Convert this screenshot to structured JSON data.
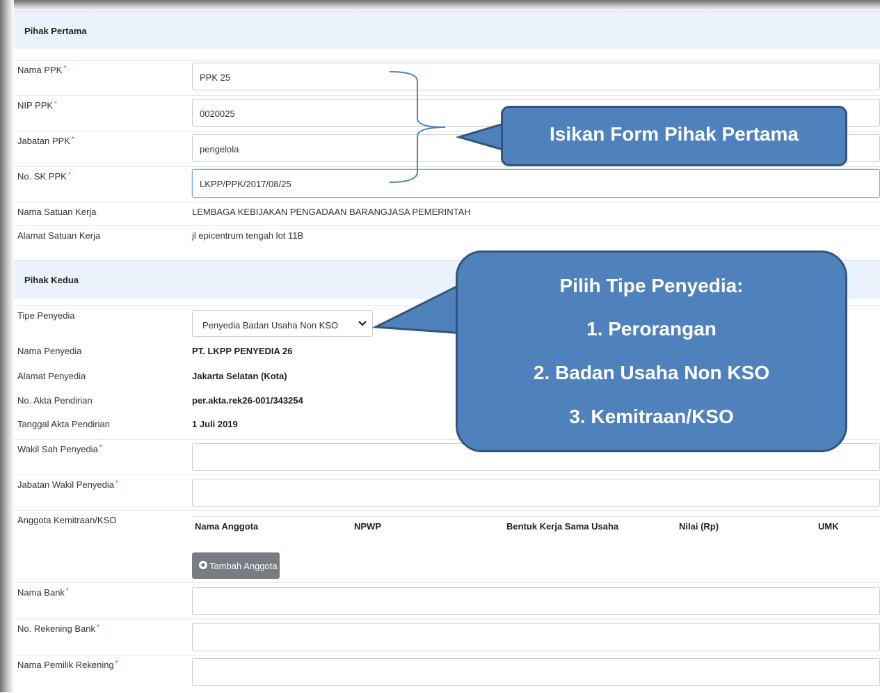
{
  "pihak_pertama": {
    "title": "Pihak Pertama",
    "nama_ppk": {
      "label": "Nama PPK",
      "value": "PPK 25"
    },
    "nip_ppk": {
      "label": "NIP PPK",
      "value": "0020025"
    },
    "jabatan_ppk": {
      "label": "Jabatan PPK",
      "value": "pengelola"
    },
    "no_sk_ppk": {
      "label": "No. SK PPK",
      "value": "LKPP/PPK/2017/08/25"
    },
    "nama_satker": {
      "label": "Nama Satuan Kerja",
      "value": "LEMBAGA KEBIJAKAN PENGADAAN BARANGJASA PEMERINTAH"
    },
    "alamat_satker": {
      "label": "Alamat Satuan Kerja",
      "value": "jl epicentrum tengah lot 11B"
    }
  },
  "pihak_kedua": {
    "title": "Pihak Kedua",
    "tipe_penyedia": {
      "label": "Tipe Penyedia",
      "value": "Penyedia Badan Usaha Non KSO"
    },
    "nama_penyedia": {
      "label": "Nama Penyedia",
      "value": "PT. LKPP PENYEDIA 26"
    },
    "alamat_penyedia": {
      "label": "Alamat Penyedia",
      "value": "Jakarta Selatan (Kota)"
    },
    "no_akta": {
      "label": "No. Akta Pendirian",
      "value": "per.akta.rek26-001/343254"
    },
    "tanggal_akta": {
      "label": "Tanggal Akta Pendirian",
      "value": "1 Juli 2019"
    },
    "wakil_sah": {
      "label": "Wakil Sah Penyedia",
      "value": ""
    },
    "jabatan_wakil": {
      "label": "Jabatan Wakil Penyedia",
      "value": ""
    },
    "anggota": {
      "label": "Anggota Kemitraan/KSO",
      "columns": [
        "Nama Anggota",
        "NPWP",
        "Bentuk Kerja Sama Usaha",
        "Nilai (Rp)",
        "UMK"
      ],
      "add_button": "Tambah Anggota"
    },
    "nama_bank": {
      "label": "Nama Bank",
      "value": ""
    },
    "no_rekening": {
      "label": "No. Rekening Bank",
      "value": ""
    },
    "nama_pemilik": {
      "label": "Nama Pemilik Rekening",
      "value": ""
    }
  },
  "required_mark": "*",
  "callout_pertama": "Isikan Form Pihak Pertama",
  "callout_tipe": {
    "title": "Pilih Tipe Penyedia:",
    "items": [
      "1. Perorangan",
      "2. Badan Usaha Non KSO",
      "3. Kemitraan/KSO"
    ]
  },
  "colors": {
    "callout_fill": "#4f81bd",
    "callout_border": "#30567f",
    "section_bg": "#eaf3fb"
  }
}
